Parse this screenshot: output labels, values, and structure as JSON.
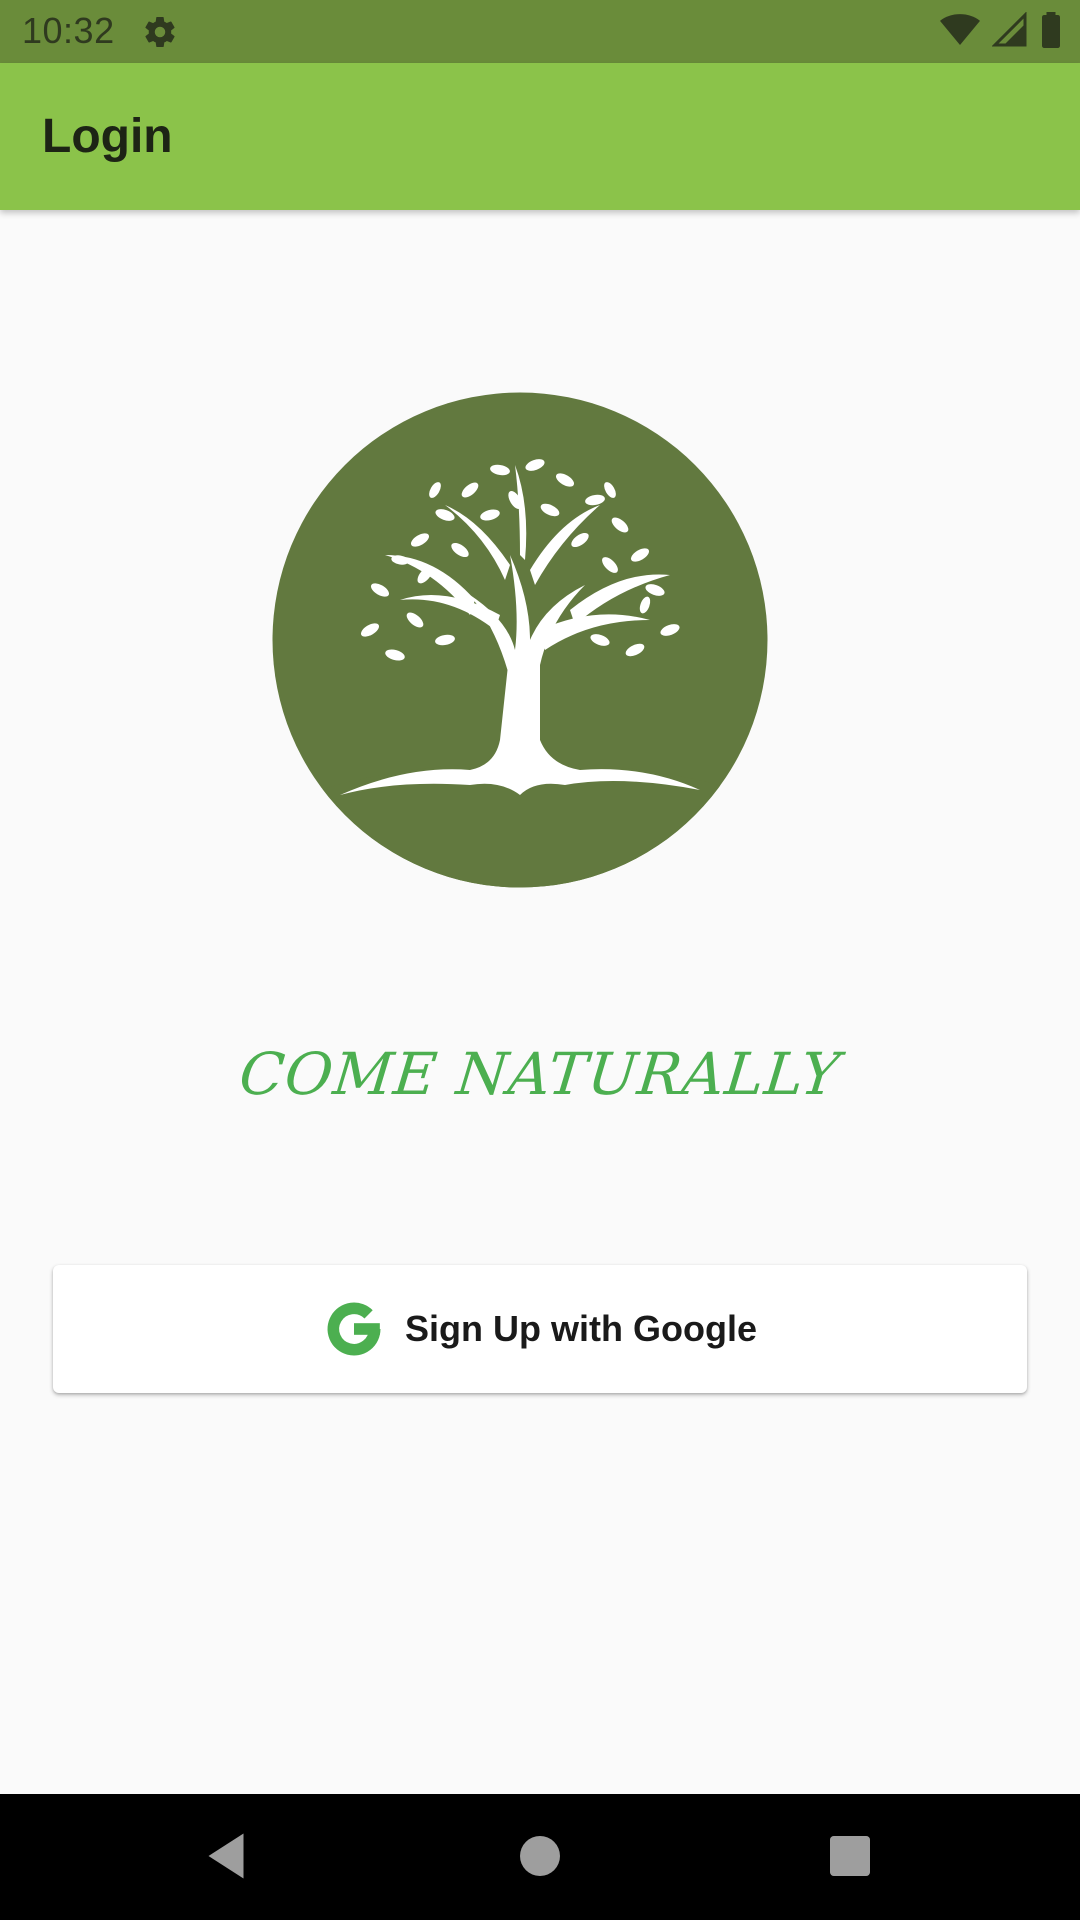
{
  "status_bar": {
    "time": "10:32",
    "icons": [
      "gear-icon",
      "wifi-icon",
      "signal-icon",
      "battery-icon"
    ]
  },
  "app_bar": {
    "title": "Login"
  },
  "logo": {
    "icon": "tree-logo"
  },
  "tagline": "COME NATURALLY",
  "google_button": {
    "icon": "google-g-icon",
    "label": "Sign Up with Google"
  },
  "nav_bar": {
    "icons": [
      "back-icon",
      "home-icon",
      "recents-icon"
    ]
  },
  "colors": {
    "status_bar": "#6a8c3a",
    "app_bar": "#8bc34a",
    "logo_circle": "#62793f",
    "tagline": "#4caf50",
    "background": "#fafafa",
    "google_g": "#4caf50"
  }
}
